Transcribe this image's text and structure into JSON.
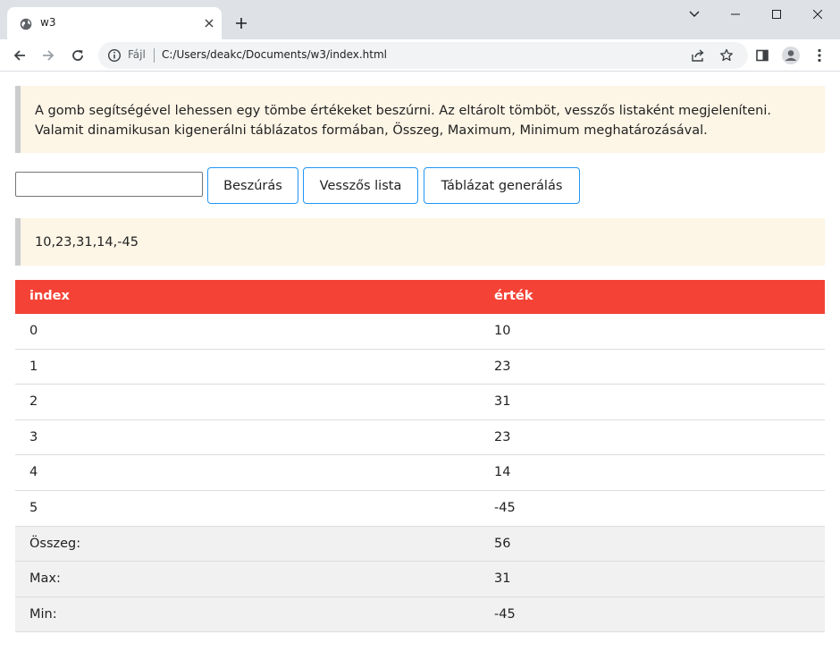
{
  "browser": {
    "tab_title": "w3",
    "scheme_label": "Fájl",
    "url": "C:/Users/deakc/Documents/w3/index.html"
  },
  "page": {
    "description_line1": "A gomb segítségével lehessen egy tömbe értékeket beszúrni. Az eltárolt tömböt, vesszős listaként megjeleníteni.",
    "description_line2": "Valamit dinamikusan kigenerálni táblázatos formában, Összeg, Maximum, Minimum meghatározásával.",
    "input_value": "",
    "buttons": {
      "insert": "Beszúrás",
      "comma_list": "Vesszős lista",
      "generate_table": "Táblázat generálás"
    },
    "list_output": "10,23,31,14,-45",
    "table": {
      "headers": [
        "index",
        "érték"
      ],
      "rows": [
        [
          "0",
          "10"
        ],
        [
          "1",
          "23"
        ],
        [
          "2",
          "31"
        ],
        [
          "3",
          "23"
        ],
        [
          "4",
          "14"
        ],
        [
          "5",
          "-45"
        ]
      ],
      "summary": [
        [
          "Összeg:",
          "56"
        ],
        [
          "Max:",
          "31"
        ],
        [
          "Min:",
          "-45"
        ]
      ]
    }
  },
  "colors": {
    "header_bg": "#f44336",
    "panel_bg": "#fdf5e6",
    "button_border": "#2196f3",
    "summary_bg": "#f1f1f1"
  }
}
